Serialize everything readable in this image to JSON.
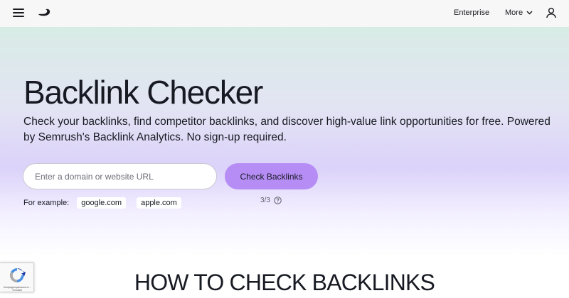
{
  "nav": {
    "enterprise_label": "Enterprise",
    "more_label": "More"
  },
  "hero": {
    "title": "Backlink Checker",
    "description": "Check your backlinks, find competitor backlinks, and discover high-value link opportunities for free. Powered by Semrush's Backlink Analytics. No sign-up required.",
    "input_placeholder": "Enter a domain or website URL",
    "input_value": "",
    "button_label": "Check Backlinks",
    "examples_label": "For example:",
    "examples": [
      "google.com",
      "apple.com"
    ],
    "counter": "3/3"
  },
  "section": {
    "heading": "HOW TO CHECK BACKLINKS"
  },
  "recaptcha": {
    "text": "Конфиденциальность - Условия"
  },
  "colors": {
    "accent": "#b68df5",
    "topbar": "#f7f7f8",
    "text": "#171a22"
  },
  "icons": [
    "menu-icon",
    "semrush-logo",
    "chevron-down-icon",
    "user-icon",
    "help-icon",
    "recaptcha-icon"
  ]
}
